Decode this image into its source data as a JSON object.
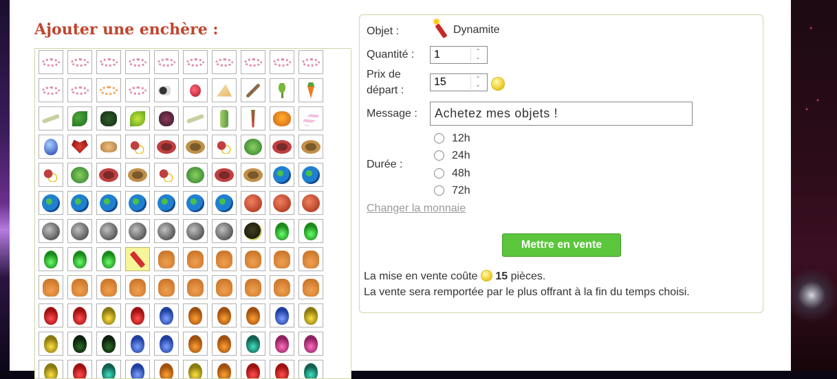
{
  "section_title": "Ajouter une enchère :",
  "inventory": [
    [
      "i-necklace",
      "i-necklace",
      "i-necklace",
      "i-necklace",
      "i-necklace",
      "i-necklace",
      "i-necklace",
      "i-necklace",
      "i-necklace",
      "i-necklace"
    ],
    [
      "i-necklace",
      "i-necklace",
      "i-necklace2",
      "i-necklace",
      "i-cloud",
      "i-radish",
      "i-cheese",
      "i-stick",
      "i-herb",
      "i-carrot"
    ],
    [
      "i-twig",
      "i-leaf",
      "i-dark",
      "i-yellowleaf",
      "i-purple",
      "i-twig",
      "i-celery",
      "i-roots",
      "i-pumpkin",
      "i-candy"
    ],
    [
      "i-egg",
      "i-heart",
      "i-bones",
      "i-eggs",
      "i-bowl",
      "i-bowl2",
      "i-eggs",
      "i-cabbage",
      "i-bowl",
      "i-bowl2"
    ],
    [
      "i-eggs",
      "i-cabbage",
      "i-bowl",
      "i-bowl2",
      "i-eggs",
      "i-cabbage",
      "i-bowl",
      "i-bowl2",
      "i-earth",
      "i-earth"
    ],
    [
      "i-earth",
      "i-earth",
      "i-earth",
      "i-earth",
      "i-earth",
      "i-earth",
      "i-earth",
      "i-mars",
      "i-mars",
      "i-mars"
    ],
    [
      "i-moon",
      "i-moon",
      "i-moon",
      "i-moon",
      "i-moon",
      "i-moon",
      "i-moon",
      "i-moon2",
      "i-potion",
      "i-potion"
    ],
    [
      "i-potion",
      "i-potion",
      "i-potion",
      "i-dyn",
      "i-bag",
      "i-bag",
      "i-bag",
      "i-bag",
      "i-bag",
      "i-bag"
    ],
    [
      "i-bag",
      "i-bag",
      "i-bag",
      "i-bag",
      "i-bag",
      "i-bag",
      "i-bag",
      "i-bag",
      "i-bag",
      "i-bag"
    ],
    [
      "p-red",
      "p-red",
      "p-yellow",
      "p-red",
      "p-blue",
      "p-orange",
      "p-orange",
      "p-orange",
      "p-blue",
      "p-yellow"
    ],
    [
      "p-yellow",
      "p-dark",
      "p-dark",
      "p-blue",
      "p-blue",
      "p-orange",
      "p-orange",
      "p-teal",
      "p-pink",
      "p-pink"
    ],
    [
      "p-yellow",
      "p-red",
      "p-teal",
      "p-blue",
      "p-orange",
      "p-yellow",
      "p-orange",
      "p-red",
      "p-red",
      "p-teal"
    ]
  ],
  "selected_item": {
    "row": 7,
    "col": 3
  },
  "form": {
    "objet_label": "Objet :",
    "objet_value": "Dynamite",
    "objet_icon": "dynamite-icon",
    "quantite_label": "Quantité :",
    "quantite_value": "1",
    "prix_label_line1": "Prix de",
    "prix_label_line2": "départ :",
    "prix_value": "15",
    "message_label": "Message :",
    "message_value": "Achetez mes objets !",
    "duree_label": "Durée :",
    "durations": [
      "12h",
      "24h",
      "48h",
      "72h"
    ],
    "change_currency": "Changer la monnaie",
    "sell_button": "Mettre en vente",
    "cost_prefix": "La mise en vente coûte",
    "cost_amount": "15",
    "cost_suffix": "pièces.",
    "note": "La vente sera remportée par le plus offrant à la fin du temps choisi."
  },
  "colors": {
    "title": "#c1442c",
    "panel_border": "#cdd5a6",
    "button": "#5bc63c",
    "selected_bg": "#f7f59a",
    "coin": "#f0d030"
  }
}
